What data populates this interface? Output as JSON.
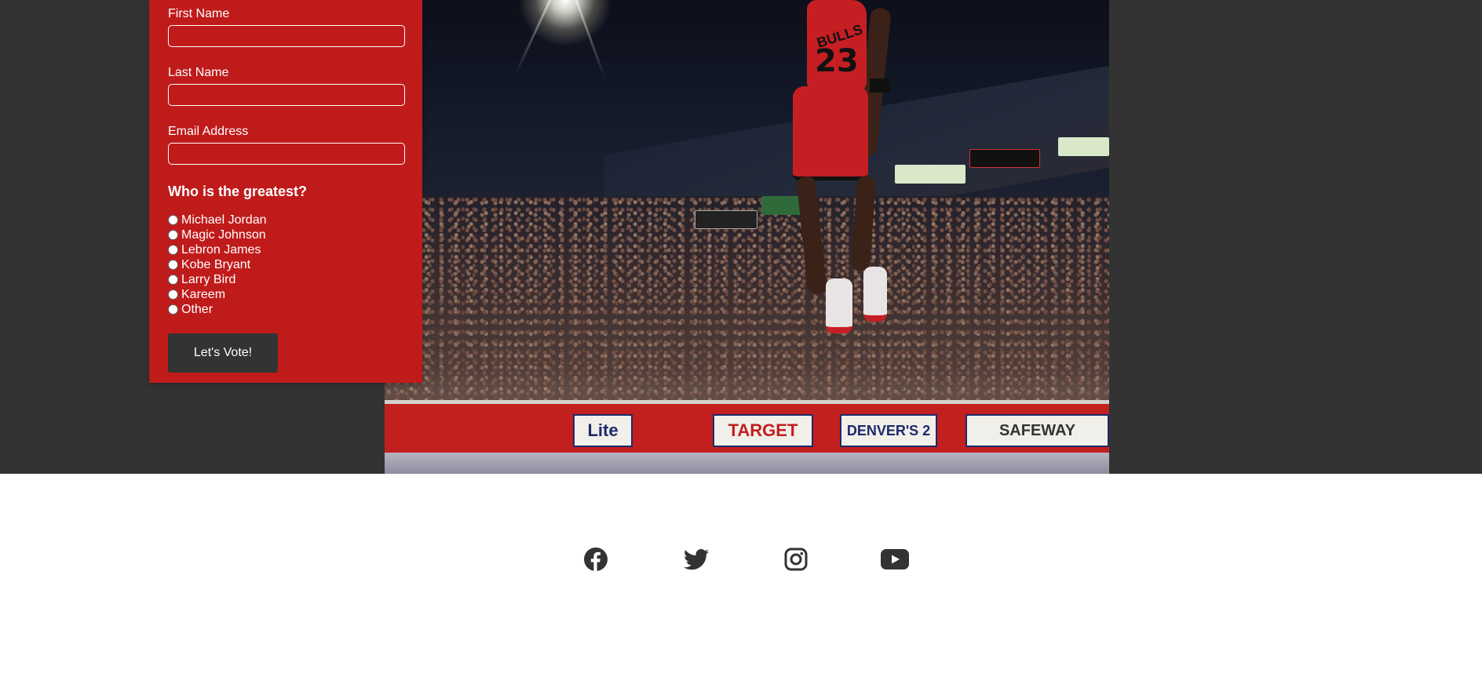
{
  "form": {
    "first_name_label": "First Name",
    "first_name_value": "",
    "last_name_label": "Last Name",
    "last_name_value": "",
    "email_label": "Email Address",
    "email_value": "",
    "question": "Who is the greatest?",
    "options": [
      "Michael Jordan",
      "Magic Johnson",
      "Lebron James",
      "Kobe Bryant",
      "Larry Bird",
      "Kareem",
      "Other"
    ],
    "submit_label": "Let's Vote!"
  },
  "photo": {
    "player_team": "BULLS",
    "player_number": "23",
    "ads": [
      "Lite",
      "TARGET",
      "DENVER'S 2",
      "SAFEWAY"
    ]
  },
  "social": {
    "icons": [
      "facebook-icon",
      "twitter-icon",
      "instagram-icon",
      "youtube-icon"
    ],
    "color": "#333333"
  },
  "colors": {
    "card_red": "#c01b1b",
    "dark": "#333333"
  }
}
